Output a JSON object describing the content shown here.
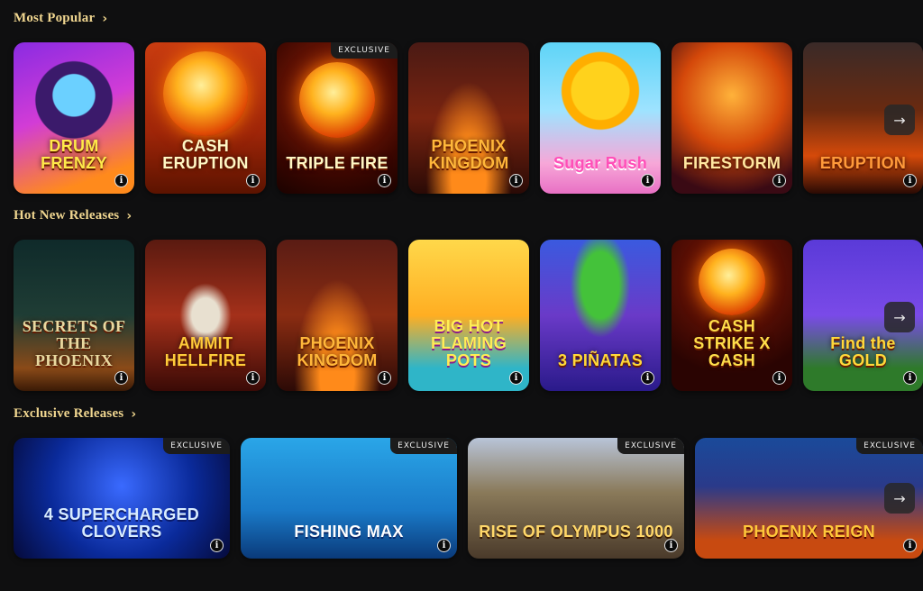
{
  "sections": {
    "most_popular": {
      "title": "Most Popular",
      "games": [
        {
          "name": "DRUM FRENZY",
          "badge": ""
        },
        {
          "name": "CASH ERUPTION",
          "badge": ""
        },
        {
          "name": "TRIPLE FIRE",
          "badge": "EXCLUSIVE"
        },
        {
          "name": "PHOENIX KINGDOM",
          "badge": ""
        },
        {
          "name": "Sugar Rush",
          "badge": ""
        },
        {
          "name": "FIRESTORM",
          "badge": ""
        },
        {
          "name": "ERUPTION",
          "badge": ""
        }
      ]
    },
    "hot_new": {
      "title": "Hot New Releases",
      "games": [
        {
          "name": "SECRETS OF THE PHOENIX",
          "badge": ""
        },
        {
          "name": "AMMIT HELLFIRE",
          "badge": ""
        },
        {
          "name": "PHOENIX KINGDOM",
          "badge": ""
        },
        {
          "name": "BIG HOT FLAMING POTS",
          "badge": ""
        },
        {
          "name": "3 PIÑATAS",
          "badge": ""
        },
        {
          "name": "CASH STRIKE X CASH",
          "badge": ""
        },
        {
          "name": "Find the GOLD",
          "badge": ""
        }
      ]
    },
    "exclusive": {
      "title": "Exclusive Releases",
      "games": [
        {
          "name": "4 SUPERCHARGED CLOVERS",
          "badge": "EXCLUSIVE"
        },
        {
          "name": "FISHING MAX",
          "badge": "EXCLUSIVE"
        },
        {
          "name": "RISE OF OLYMPUS 1000",
          "badge": "EXCLUSIVE"
        },
        {
          "name": "PHOENIX REIGN",
          "badge": "EXCLUSIVE"
        }
      ]
    }
  },
  "icons": {
    "info": "i",
    "chevron": "›",
    "arrow": "→"
  }
}
